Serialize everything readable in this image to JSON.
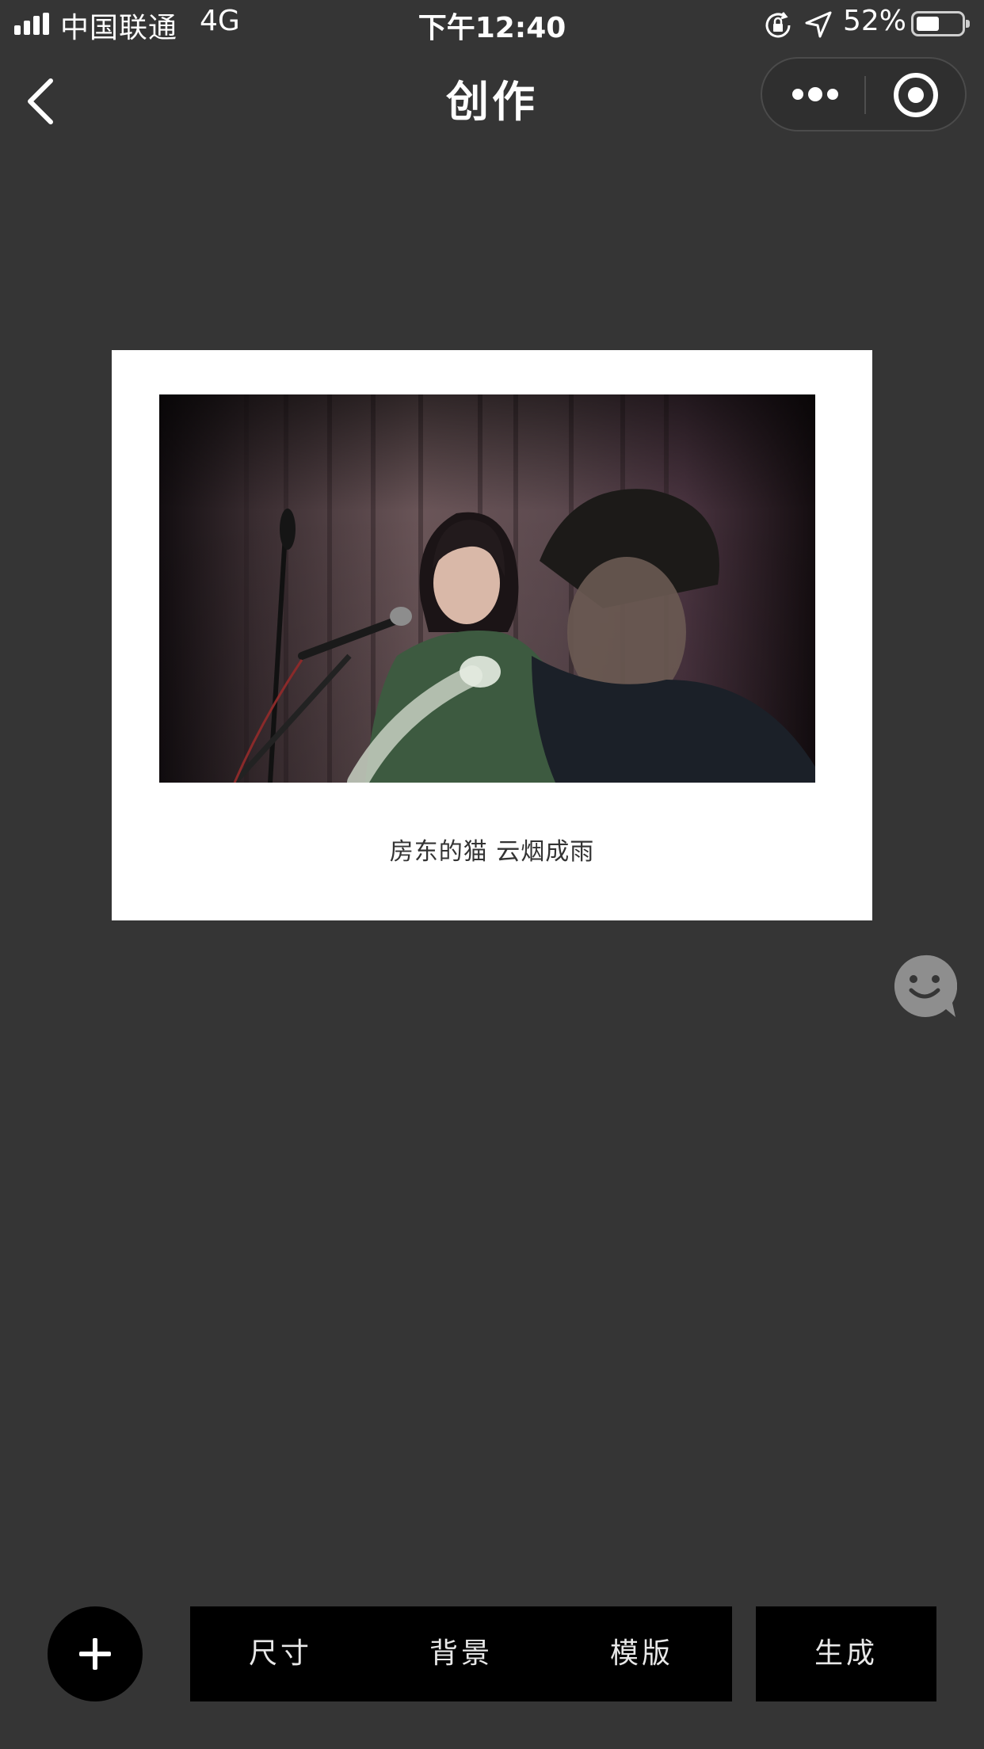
{
  "status_bar": {
    "carrier": "中国联通",
    "network": "4G",
    "time": "下午12:40",
    "battery_percent_label": "52%",
    "battery_level": 0.52,
    "signal_bars": 4,
    "icons": [
      "signal-icon",
      "orientation-lock-icon",
      "location-arrow-icon",
      "battery-icon"
    ]
  },
  "nav": {
    "title": "创作",
    "back_icon": "chevron-left-icon",
    "capsule_icons": [
      "more-dots-icon",
      "close-miniprogram-icon"
    ]
  },
  "card": {
    "caption": "房东的猫 云烟成雨",
    "photo_icon": "concert-photo"
  },
  "floating": {
    "emoji_icon": "smiley-chat-icon",
    "color": "#8e8e8e"
  },
  "toolbar": {
    "add_icon": "plus-icon",
    "size_label": "尺寸",
    "background_label": "背景",
    "template_label": "模版",
    "generate_label": "生成"
  },
  "colors": {
    "page_background": "#353535",
    "toolbar_background": "#000000",
    "card_background": "#ffffff"
  }
}
